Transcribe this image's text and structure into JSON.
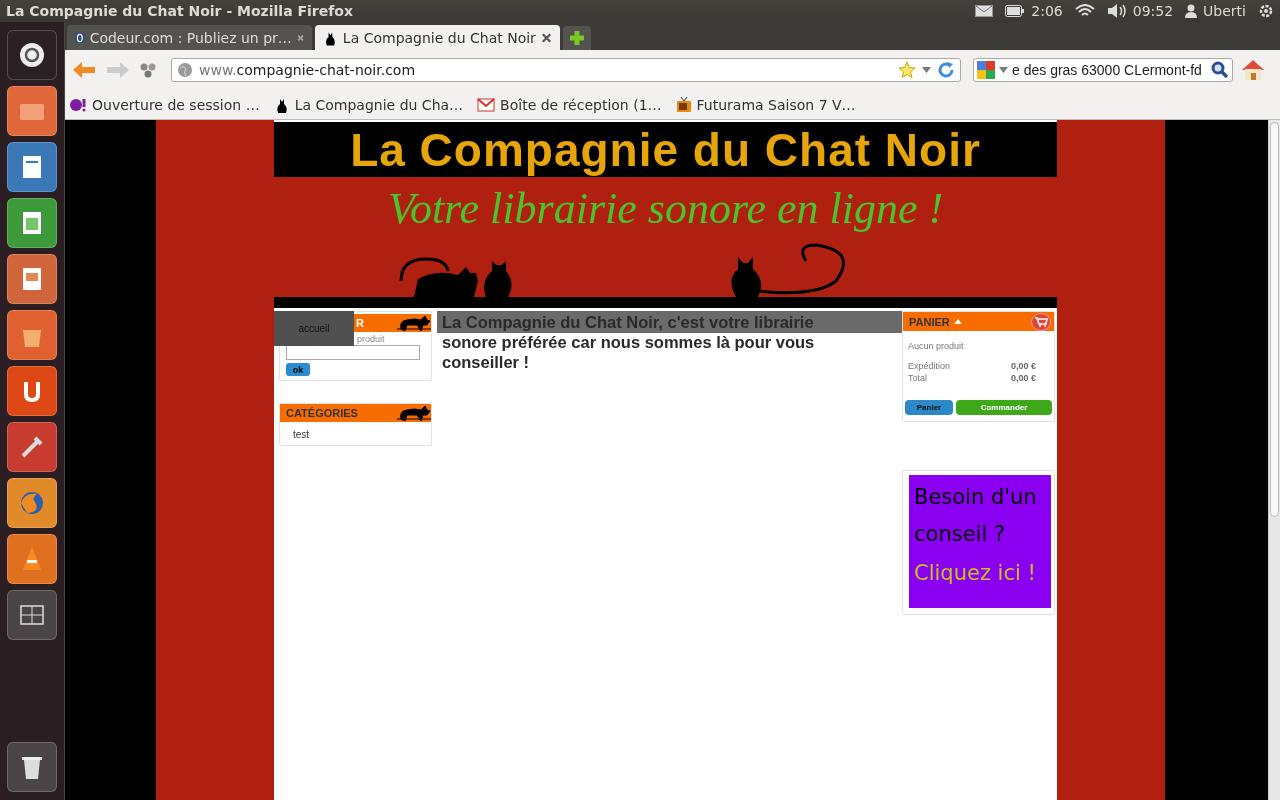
{
  "os_panel": {
    "title": "La Compagnie du Chat Noir - Mozilla Firefox",
    "battery_time": "2:06",
    "clock": "09:52",
    "user": "Uberti"
  },
  "tabs": [
    {
      "label": "Codeur.com : Publiez un pr…",
      "selected": false
    },
    {
      "label": "La Compagnie du Chat Noir",
      "selected": true
    }
  ],
  "address_bar": {
    "prefix": "www.",
    "host": "compagnie-chat-noir.com"
  },
  "search_box": {
    "value": "e des gras 63000 CLermont-fd"
  },
  "bookmarks": [
    {
      "label": "Ouverture de session …",
      "kind": "yahoo"
    },
    {
      "label": "La Compagnie du Cha…",
      "kind": "cat"
    },
    {
      "label": "Boîte de réception (1…",
      "kind": "mail"
    },
    {
      "label": "Futurama Saison 7 V…",
      "kind": "tv"
    }
  ],
  "page": {
    "banner_title": "La Compagnie du Chat Noir",
    "banner_subtitle": "Votre librairie sonore en ligne !",
    "nav": [
      {
        "label": "accueil"
      }
    ],
    "search_widget": {
      "title": "R",
      "hint": "produit",
      "button": "ok"
    },
    "categories": {
      "title": "CATÉGORIES",
      "items": [
        "test"
      ]
    },
    "intro": "La Compagnie du Chat Noir, c'est votre librairie sonore préférée car nous sommes là pour vous conseiller !",
    "cart": {
      "title": "PANIER",
      "empty": "Aucun produit",
      "rows": [
        {
          "label": "Expédition",
          "value": "0,00 €"
        },
        {
          "label": "Total",
          "value": "0,00 €"
        }
      ],
      "buttons": [
        "Panier",
        "Commander"
      ]
    },
    "promo": {
      "line1": "Besoin d'un conseil ?",
      "line2": "Cliquez ici !"
    }
  }
}
